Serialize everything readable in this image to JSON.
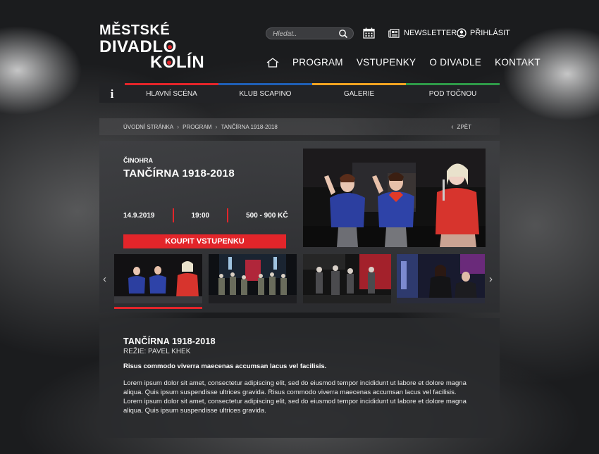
{
  "logo": {
    "line1": "MĚSTSKÉ",
    "line2": "DIVADLO",
    "line3": "KOLÍN"
  },
  "search": {
    "placeholder": "Hledat.."
  },
  "top_links": {
    "newsletter": "NEWSLETTER",
    "login": "PŘIHLÁSIT"
  },
  "main_nav": [
    "PROGRAM",
    "VSTUPENKY",
    "O DIVADLE",
    "KONTAKT"
  ],
  "sub_nav": {
    "info": "i",
    "items": [
      "HLAVNÍ SCÉNA",
      "KLUB SCAPINO",
      "GALERIE",
      "POD TOČNOU"
    ],
    "colors": [
      "#e3252a",
      "#1f5fb5",
      "#f0a321",
      "#2e9a48"
    ]
  },
  "breadcrumb": {
    "items": [
      "ÚVODNÍ STRÁNKA",
      "PROGRAM",
      "TANČÍRNA 1918-2018"
    ],
    "back": "ZPĚT"
  },
  "event": {
    "genre": "ČINOHRA",
    "title": "TANČÍRNA 1918-2018",
    "date": "14.9.2019",
    "time": "19:00",
    "price": "500 - 900 KČ",
    "buy_label": "KOUPIT VSTUPENKU"
  },
  "gallery": {
    "prev": "‹",
    "next": "›",
    "active_index": 0
  },
  "description": {
    "title": "TANČÍRNA 1918-2018",
    "director": "REŽIE: PAVEL KHEK",
    "lead": "Risus commodo viverra maecenas accumsan lacus vel facilisis.",
    "body": "Lorem ipsum dolor sit amet, consectetur adipiscing elit, sed do eiusmod tempor incididunt ut labore et dolore magna aliqua. Quis ipsum suspendisse ultrices gravida. Risus commodo viverra maecenas accumsan lacus vel facilisis.  Lorem ipsum dolor sit amet, consectetur adipiscing elit, sed do eiusmod tempor incididunt ut labore et dolore magna aliqua. Quis ipsum suspendisse ultrices gravida."
  },
  "colors": {
    "accent": "#e3252a"
  }
}
